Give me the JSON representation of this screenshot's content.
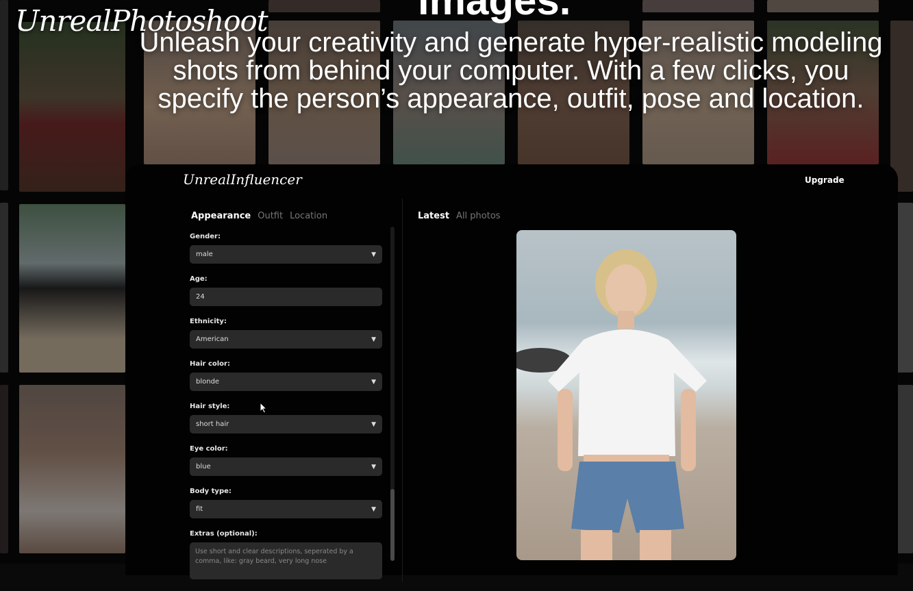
{
  "brand": {
    "name": "UnrealPhotoshoot"
  },
  "headline_fragment": "images.",
  "hero_text": "Unleash your creativity and generate hyper-realistic modeling shots from behind your computer. With a few clicks, you specify the person’s appearance, outfit, pose and location.",
  "app": {
    "logo": "UnrealInfluencer",
    "upgrade_label": "Upgrade",
    "left_tabs": [
      {
        "label": "Appearance",
        "active": true
      },
      {
        "label": "Outfit",
        "active": false
      },
      {
        "label": "Location",
        "active": false
      }
    ],
    "right_tabs": [
      {
        "label": "Latest",
        "active": true
      },
      {
        "label": "All photos",
        "active": false
      }
    ],
    "form": {
      "gender": {
        "label": "Gender:",
        "value": "male"
      },
      "age": {
        "label": "Age:",
        "value": "24"
      },
      "ethnicity": {
        "label": "Ethnicity:",
        "value": "American"
      },
      "hair_color": {
        "label": "Hair color:",
        "value": "blonde"
      },
      "hair_style": {
        "label": "Hair style:",
        "value": "short hair"
      },
      "eye_color": {
        "label": "Eye color:",
        "value": "blue"
      },
      "body_type": {
        "label": "Body type:",
        "value": "fit"
      },
      "extras": {
        "label": "Extras (optional):",
        "placeholder": "Use short and clear descriptions, seperated by a comma, like: gray beard, very long nose"
      }
    }
  },
  "colors": {
    "background": "#0a0a0a",
    "panel": "#020202",
    "field": "#2a2a2a",
    "muted_tab": "#777777"
  }
}
